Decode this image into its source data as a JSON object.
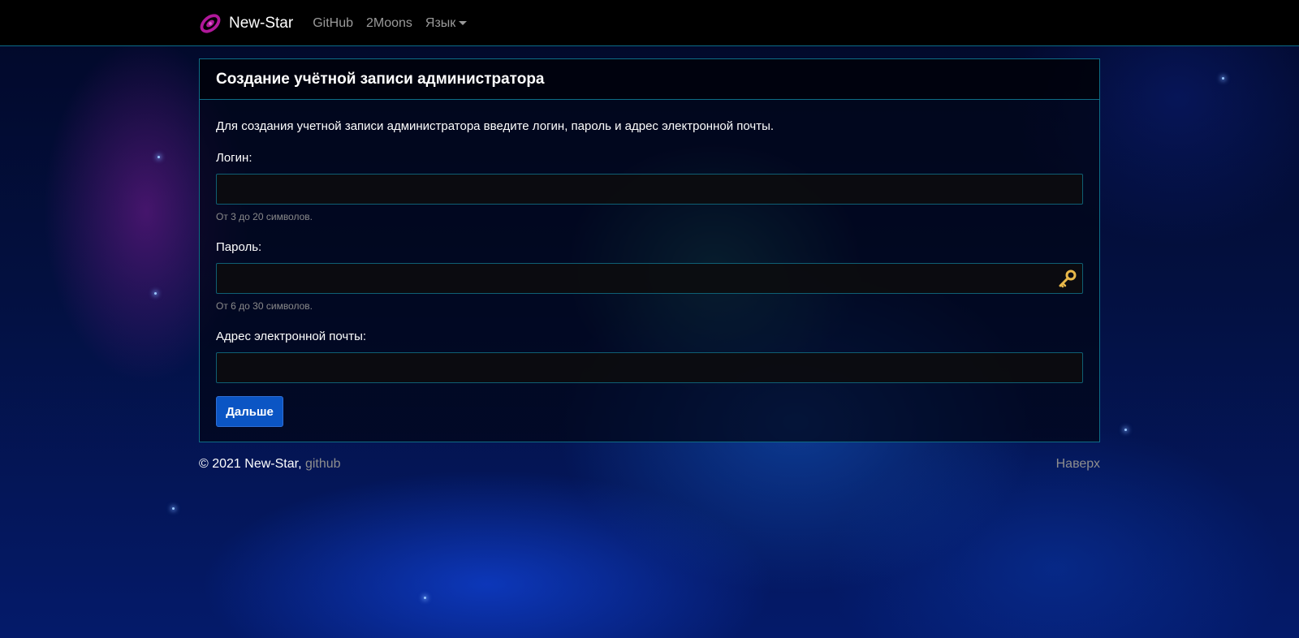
{
  "navbar": {
    "brand": "New-Star",
    "links": [
      "GitHub",
      "2Moons"
    ],
    "language_label": "Язык"
  },
  "card": {
    "title": "Создание учётной записи администратора",
    "intro": "Для создания учетной записи администратора введите логин, пароль и адрес электронной почты.",
    "fields": {
      "login": {
        "label": "Логин:",
        "value": "",
        "hint": "От 3 до 20 символов."
      },
      "password": {
        "label": "Пароль:",
        "value": "",
        "hint": "От 6 до 30 символов."
      },
      "email": {
        "label": "Адрес электронной почты:",
        "value": ""
      }
    },
    "next_button": "Дальше"
  },
  "footer": {
    "copyright": "© 2021 New-Star,",
    "github": "github",
    "to_top": "Наверх"
  },
  "colors": {
    "accent_border": "#0e6d86",
    "button": "#0b55c4",
    "logo": "#b0189a"
  }
}
